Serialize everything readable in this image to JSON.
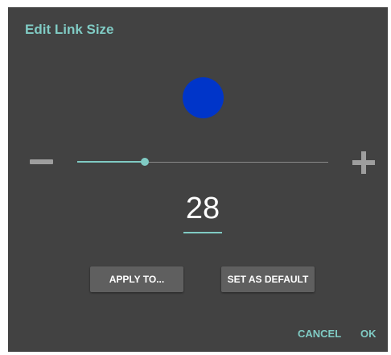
{
  "dialog": {
    "title": "Edit Link Size",
    "accent_color": "#80cbc4",
    "background_color": "#424242"
  },
  "preview": {
    "color": "#0035c9"
  },
  "slider": {
    "fraction": 0.27,
    "decrease_icon": "minus-icon",
    "increase_icon": "plus-icon"
  },
  "size_field": {
    "value": "28"
  },
  "buttons": {
    "apply_label": "APPLY TO...",
    "default_label": "SET AS DEFAULT",
    "cancel_label": "CANCEL",
    "ok_label": "OK"
  }
}
